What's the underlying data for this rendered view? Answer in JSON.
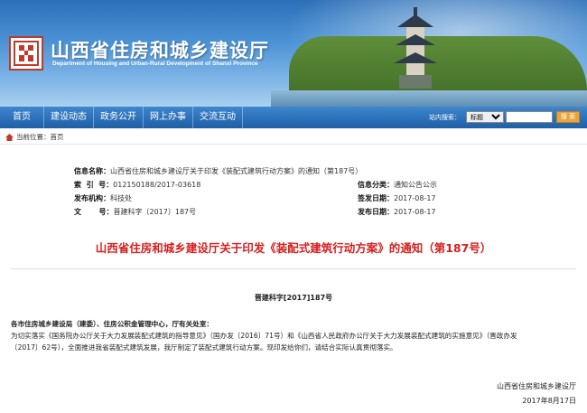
{
  "header": {
    "site_title": "山西省住房和城乡建设厅",
    "site_subtitle": "Department of Housing and Urban-Rural Development of Shanxi Province"
  },
  "nav": {
    "items": [
      "首页",
      "建设动态",
      "政务公开",
      "网上办事",
      "交流互动"
    ],
    "search_label": "站内搜索：",
    "search_select": "标题",
    "search_placeholder": "",
    "search_button": "搜 索"
  },
  "breadcrumb": {
    "text": "当前位置：首页"
  },
  "meta": {
    "info_name_label": "信息名称：",
    "info_name_value": "山西省住房和城乡建设厅关于印发《装配式建筑行动方案》的通知（第187号）",
    "index_label": "索  引  号：",
    "index_value": "012150188/2017-03618",
    "category_label": "信息分类：",
    "category_value": "通知公告公示",
    "publisher_label": "发布机构：",
    "publisher_value": "科技处",
    "sign_date_label": "签发日期：",
    "sign_date_value": "2017-08-17",
    "doc_label": "文       号：",
    "doc_value": "晋建科字〔2017〕187号",
    "pub_date_label": "发布日期：",
    "pub_date_value": "2017-08-17"
  },
  "document": {
    "title": "山西省住房和城乡建设厅关于印发《装配式建筑行动方案》的通知（第187号）",
    "number": "晋建科字[2017]187号",
    "addressee": "各市住房城乡建设局（建委）、住房公积金管理中心，厅有关处室：",
    "body_line1": "为切实落实《国务院办公厅关于大力发展装配式建筑的指导意见》（国办发〔2016〕71号）和《山西省人民政府办公厅关于大力发展装配式建筑的实施意见》（晋政办发",
    "body_line2": "〔2017〕62号），全面推进我省装配式建筑发展，我厅制定了装配式建筑行动方案。现印发给你们，请结合实际认真贯彻落实。",
    "signer": "山西省住房和城乡建设厅",
    "date": "2017年8月17日"
  },
  "colors": {
    "nav_blue": "#1f5fa6",
    "title_red": "#d41f1f",
    "logo_red": "#c0392b"
  }
}
